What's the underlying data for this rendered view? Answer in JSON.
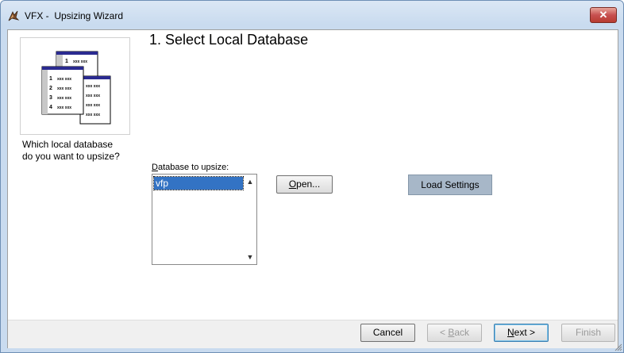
{
  "window": {
    "title": "VFX -  Upsizing Wizard",
    "close_label": "✕"
  },
  "step": {
    "heading": "1. Select Local Database",
    "question_line1": "Which local database",
    "question_line2": "do you want to upsize?"
  },
  "database": {
    "label_prefix": "D",
    "label_rest": "atabase to upsize:",
    "items": [
      "vfp"
    ],
    "selected": "vfp"
  },
  "buttons": {
    "open_prefix": "O",
    "open_rest": "pen...",
    "load_settings": "Load Settings",
    "cancel": "Cancel",
    "back_prefix": "< ",
    "back_u": "B",
    "back_rest": "ack",
    "next_u": "N",
    "next_rest": "ext >",
    "finish": "Finish"
  },
  "illustration": {
    "rows": [
      "1",
      "2",
      "3",
      "4"
    ],
    "cell": "xxx"
  }
}
